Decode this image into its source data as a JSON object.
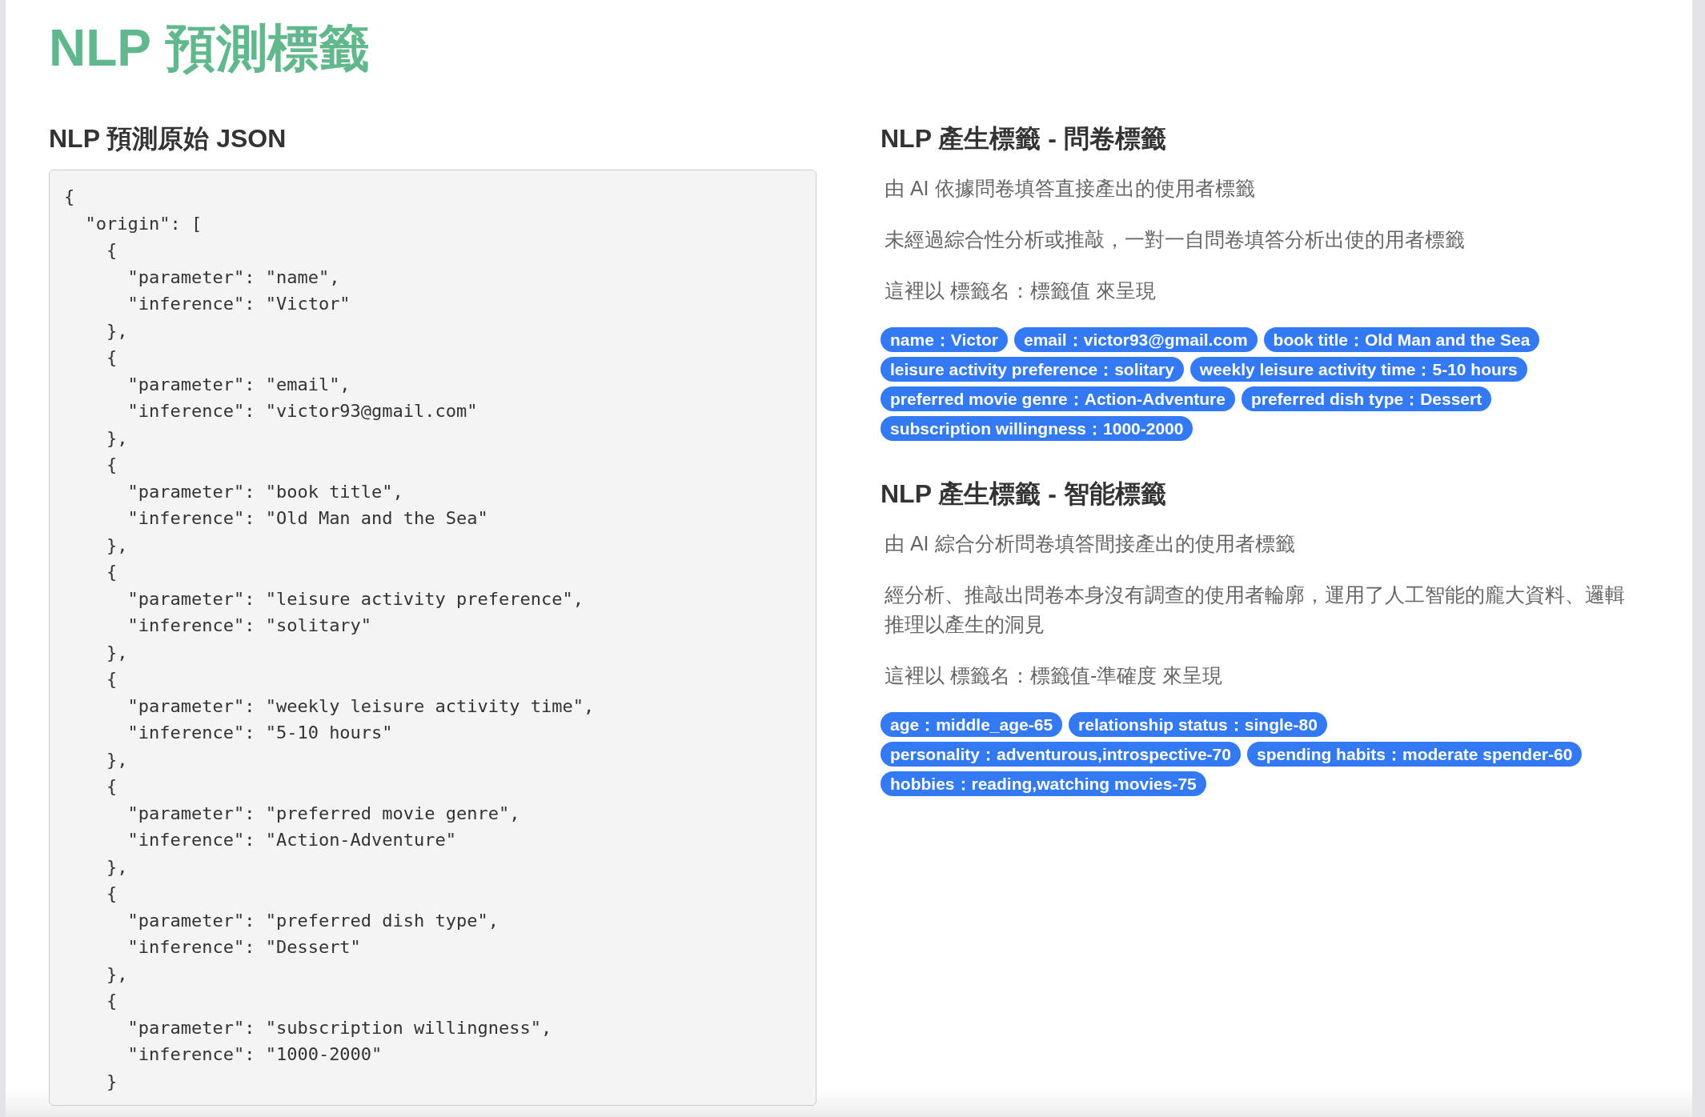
{
  "title": "NLP 預測標籤",
  "raw_json_panel": {
    "heading": "NLP 預測原始 JSON",
    "code_lines": [
      "{",
      "  \"origin\": [",
      "    {",
      "      \"parameter\": \"name\",",
      "      \"inference\": \"Victor\"",
      "    },",
      "    {",
      "      \"parameter\": \"email\",",
      "      \"inference\": \"victor93@gmail.com\"",
      "    },",
      "    {",
      "      \"parameter\": \"book title\",",
      "      \"inference\": \"Old Man and the Sea\"",
      "    },",
      "    {",
      "      \"parameter\": \"leisure activity preference\",",
      "      \"inference\": \"solitary\"",
      "    },",
      "    {",
      "      \"parameter\": \"weekly leisure activity time\",",
      "      \"inference\": \"5-10 hours\"",
      "    },",
      "    {",
      "      \"parameter\": \"preferred movie genre\",",
      "      \"inference\": \"Action-Adventure\"",
      "    },",
      "    {",
      "      \"parameter\": \"preferred dish type\",",
      "      \"inference\": \"Dessert\"",
      "    },",
      "    {",
      "      \"parameter\": \"subscription willingness\",",
      "      \"inference\": \"1000-2000\"",
      "    }"
    ]
  },
  "tag_sections": [
    {
      "heading": "NLP 產生標籤 - 問卷標籤",
      "descriptions": [
        "由 AI 依據問卷填答直接產出的使用者標籤",
        "未經過綜合性分析或推敲，一對一自問卷填答分析出使的用者標籤",
        "這裡以 標籤名：標籤值 來呈現"
      ],
      "tags": [
        "name：Victor",
        "email：victor93@gmail.com",
        "book title：Old Man and the Sea",
        "leisure activity preference：solitary",
        "weekly leisure activity time：5-10 hours",
        "preferred movie genre：Action-Adventure",
        "preferred dish type：Dessert",
        "subscription willingness：1000-2000"
      ]
    },
    {
      "heading": "NLP 產生標籤 - 智能標籤",
      "descriptions": [
        "由 AI 綜合分析問卷填答間接產出的使用者標籤",
        "經分析、推敲出問卷本身沒有調查的使用者輪廓，運用了人工智能的龐大資料、邏輯推理以產生的洞見",
        "這裡以 標籤名：標籤值-準確度 來呈現"
      ],
      "tags": [
        "age：middle_age-65",
        "relationship status：single-80",
        "personality：adventurous,introspective-70",
        "spending habits：moderate spender-60",
        "hobbies：reading,watching movies-75"
      ]
    }
  ]
}
